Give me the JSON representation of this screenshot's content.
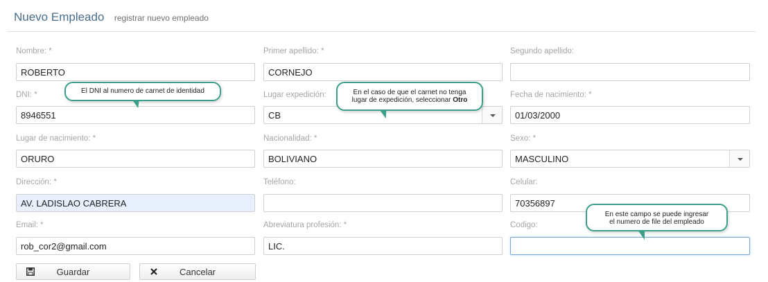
{
  "header": {
    "title": "Nuevo Empleado",
    "subtitle": "registrar nuevo empleado"
  },
  "fields": {
    "nombre": {
      "label": "Nombre: *",
      "value": "ROBERTO"
    },
    "primer_apellido": {
      "label": "Primer apellido: *",
      "value": "CORNEJO"
    },
    "segundo_apellido": {
      "label": "Segundo apellido:",
      "value": ""
    },
    "dni": {
      "label": "DNI: *",
      "value": "8946551"
    },
    "lugar_expedicion": {
      "label": "Lugar expedición:",
      "value": "CB"
    },
    "fecha_nacimiento": {
      "label": "Fecha de nacimiento: *",
      "value": "01/03/2000"
    },
    "lugar_nacimiento": {
      "label": "Lugar de nacimiento: *",
      "value": "ORURO"
    },
    "nacionalidad": {
      "label": "Nacionalidad: *",
      "value": "BOLIVIANO"
    },
    "sexo": {
      "label": "Sexo: *",
      "value": "MASCULINO"
    },
    "direccion": {
      "label": "Dirección: *",
      "value": "AV. LADISLAO CABRERA"
    },
    "telefono": {
      "label": "Teléfono:",
      "value": ""
    },
    "celular": {
      "label": "Celular:",
      "value": "70356897"
    },
    "email": {
      "label": "Email: *",
      "value": "rob_cor2@gmail.com"
    },
    "abreviatura": {
      "label": "Abreviatura profesión: *",
      "value": "LIC."
    },
    "codigo": {
      "label": "Codigo:",
      "value": ""
    }
  },
  "buttons": {
    "save": "Guardar",
    "cancel": "Cancelar"
  },
  "tooltips": {
    "dni": "El DNI al numero de carnet de identidad",
    "expedicion_line1": "En el caso de que el carnet no tenga",
    "expedicion_line2": "lugar de expedición, seleccionar ",
    "expedicion_bold": "Otro",
    "codigo_line1": "En este campo se puede ingresar",
    "codigo_line2": "el numero de file del empleado"
  },
  "icons": {
    "save": "floppy-disk-icon",
    "cancel": "close-icon",
    "dropdown": "caret-down-icon"
  },
  "colors": {
    "tooltip_border": "#3aa08a",
    "title": "#4a6d8c",
    "autofill_bg": "#e8f0fe"
  }
}
